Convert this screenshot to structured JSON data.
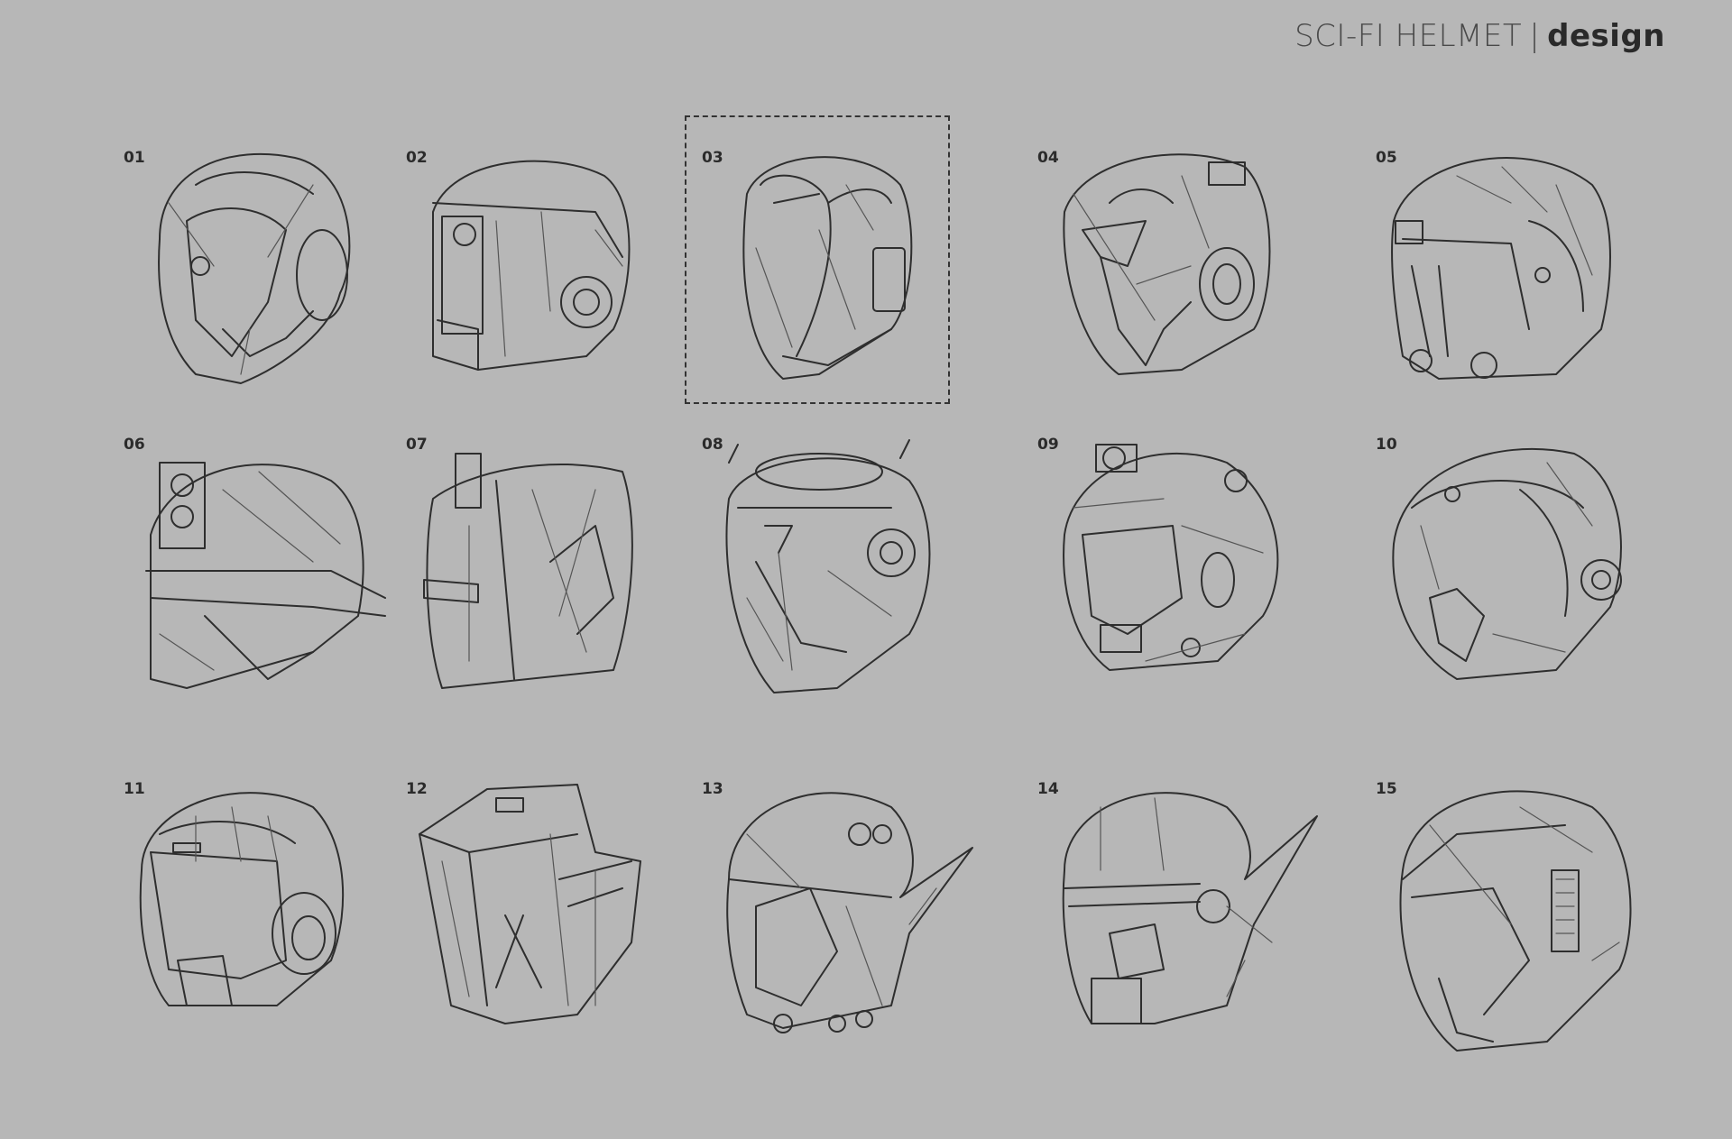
{
  "header": {
    "title": "SCI-FI HELMET",
    "separator": "|",
    "subtitle": "design"
  },
  "colors": {
    "background": "#b7b7b7",
    "ink": "#2e2e2e"
  },
  "selected": "03",
  "sketches": [
    {
      "label": "01"
    },
    {
      "label": "02"
    },
    {
      "label": "03"
    },
    {
      "label": "04"
    },
    {
      "label": "05"
    },
    {
      "label": "06"
    },
    {
      "label": "07"
    },
    {
      "label": "08"
    },
    {
      "label": "09"
    },
    {
      "label": "10"
    },
    {
      "label": "11"
    },
    {
      "label": "12"
    },
    {
      "label": "13"
    },
    {
      "label": "14"
    },
    {
      "label": "15"
    }
  ]
}
